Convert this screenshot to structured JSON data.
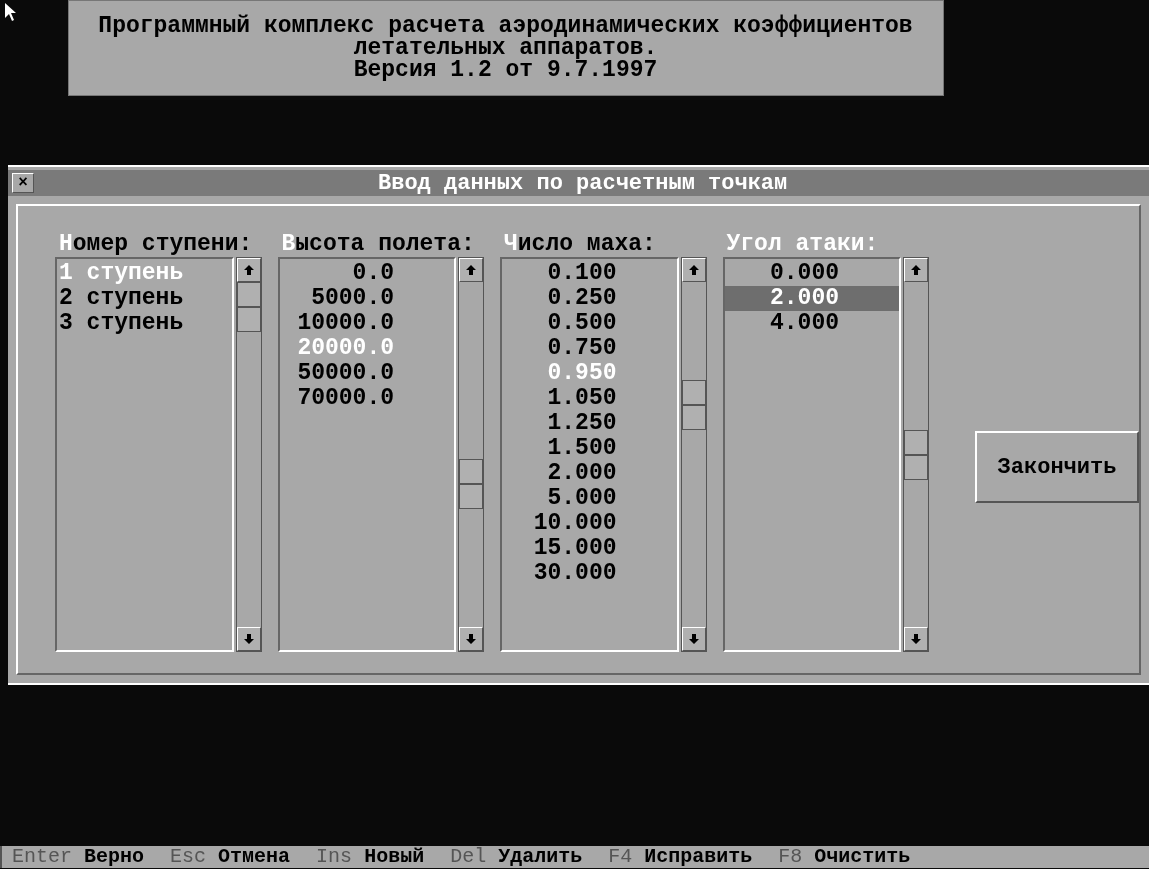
{
  "banner": {
    "lines": [
      "Программный комплекс расчета аэродинамических коэффициентов",
      "летательных аппаратов.",
      "Версия 1.2 от 9.7.1997"
    ]
  },
  "dialog": {
    "title": "Ввод данных по расчетным точкам",
    "close": "×",
    "lists": [
      {
        "hotkey": "Н",
        "label": "омер ступени:",
        "focused": false,
        "kind": "text",
        "items": [
          {
            "text": "1 ступень",
            "selected": true
          },
          {
            "text": "2 ступень",
            "selected": false
          },
          {
            "text": "3 ступень",
            "selected": false
          }
        ]
      },
      {
        "hotkey": "В",
        "label": "ысота полета:",
        "focused": false,
        "kind": "number",
        "items": [
          {
            "text": "0.0",
            "selected": false
          },
          {
            "text": "5000.0",
            "selected": false
          },
          {
            "text": "10000.0",
            "selected": false
          },
          {
            "text": "20000.0",
            "selected": true
          },
          {
            "text": "50000.0",
            "selected": false
          },
          {
            "text": "70000.0",
            "selected": false
          }
        ]
      },
      {
        "hotkey": "Ч",
        "label": "исло маха:",
        "focused": false,
        "kind": "number",
        "items": [
          {
            "text": "0.100",
            "selected": false
          },
          {
            "text": "0.250",
            "selected": false
          },
          {
            "text": "0.500",
            "selected": false
          },
          {
            "text": "0.750",
            "selected": false
          },
          {
            "text": "0.950",
            "selected": true
          },
          {
            "text": "1.050",
            "selected": false
          },
          {
            "text": "1.250",
            "selected": false
          },
          {
            "text": "1.500",
            "selected": false
          },
          {
            "text": "2.000",
            "selected": false
          },
          {
            "text": "5.000",
            "selected": false
          },
          {
            "text": "10.000",
            "selected": false
          },
          {
            "text": "15.000",
            "selected": false
          },
          {
            "text": "30.000",
            "selected": false
          }
        ]
      },
      {
        "hotkey": "У",
        "label": "гол атаки:",
        "focused": true,
        "kind": "number",
        "items": [
          {
            "text": "0.000",
            "selected": false
          },
          {
            "text": "2.000",
            "selected": true
          },
          {
            "text": "4.000",
            "selected": false
          }
        ]
      }
    ],
    "button": "Закончить"
  },
  "status_bar": [
    {
      "key": "Enter",
      "label": "Верно"
    },
    {
      "key": "Esc",
      "label": "Отмена"
    },
    {
      "key": "Ins",
      "label": "Новый"
    },
    {
      "key": "Del",
      "label": "Удалить"
    },
    {
      "key": "F4",
      "label": "Исправить"
    },
    {
      "key": "F8",
      "label": "Очистить"
    }
  ]
}
